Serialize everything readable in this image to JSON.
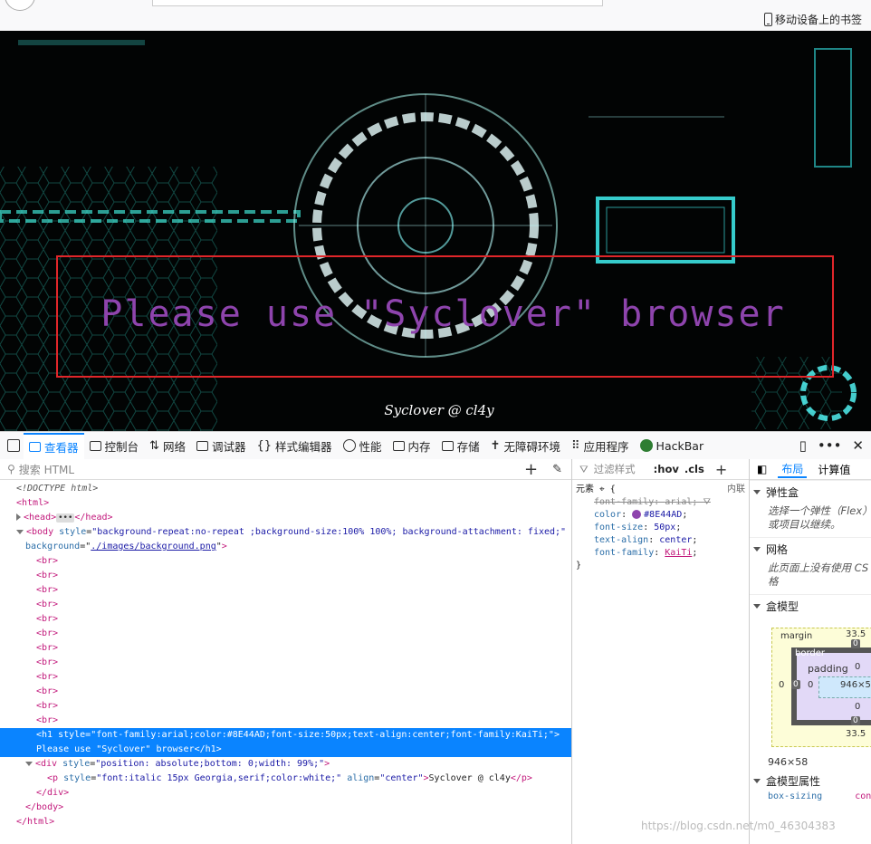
{
  "browser": {
    "bookmark_label": "移动设备上的书签"
  },
  "page": {
    "heading": "Please use \"Syclover\" browser",
    "footer": "Syclover @ cl4y",
    "heading_color": "#8E44AD",
    "highlight_color": "#e0262a"
  },
  "devtools": {
    "tabs": [
      {
        "label": "查看器",
        "icon": "inspector-icon"
      },
      {
        "label": "控制台",
        "icon": "console-icon"
      },
      {
        "label": "网络",
        "icon": "network-icon"
      },
      {
        "label": "调试器",
        "icon": "debugger-icon"
      },
      {
        "label": "样式编辑器",
        "icon": "style-editor-icon"
      },
      {
        "label": "性能",
        "icon": "performance-icon"
      },
      {
        "label": "内存",
        "icon": "memory-icon"
      },
      {
        "label": "存储",
        "icon": "storage-icon"
      },
      {
        "label": "无障碍环境",
        "icon": "accessibility-icon"
      },
      {
        "label": "应用程序",
        "icon": "application-icon"
      },
      {
        "label": "HackBar",
        "icon": "hackbar-icon"
      }
    ],
    "search_placeholder": "搜索 HTML",
    "filter_placeholder": "过滤样式",
    "hov": ":hov",
    "cls": ".cls",
    "rule_selector": "元素",
    "rule_source": "内联",
    "rules": {
      "decl1_prop": "font-family",
      "decl1_val": "arial",
      "decl2_prop": "color",
      "decl2_val": "#8E44AD",
      "decl3_prop": "font-size",
      "decl3_val": "50px",
      "decl4_prop": "text-align",
      "decl4_val": "center",
      "decl5_prop": "font-family",
      "decl5_val": "KaiTi"
    },
    "html": {
      "doctype": "<!DOCTYPE html>",
      "html_open": "<html>",
      "head_open": "<head>",
      "head_close": "</head>",
      "body_open": "<body",
      "body_style_attr": "style",
      "body_style_val": "\"background-repeat:no-repeat ;background-size:100% 100%; background-attachment: fixed;\"",
      "body_bg_attr": "background",
      "body_bg_val": "./images/background.png",
      "br": "<br>",
      "h1_line": "<h1 style=\"font-family:arial;color:#8E44AD;font-size:50px;text-align:center;font-family:KaiTi;\">",
      "h1_text": "Please use \"Syclover\" browser</h1>",
      "div_open": "<div",
      "div_style_attr": "style",
      "div_style_val": "\"position: absolute;bottom: 0;width: 99%;\"",
      "p_open": "<p",
      "p_style_attr": "style",
      "p_style_val": "\"font:italic 15px Georgia,serif;color:white;\"",
      "p_align_attr": "align",
      "p_align_val": "\"center\"",
      "p_text": "Syclover @ cl4y",
      "p_close": "</p>",
      "div_close": "</div>",
      "body_close": "</body>",
      "html_close": "</html>"
    },
    "right_tabs": {
      "layout": "布局",
      "computed": "计算值"
    },
    "flex_title": "弹性盒",
    "flex_body_1": "选择一个弹性（Flex）",
    "flex_body_2": "或项目以继续。",
    "grid_title": "网格",
    "grid_body_1": "此页面上没有使用 CS",
    "grid_body_2": "格",
    "boxmodel_title": "盒模型",
    "boxmodel": {
      "margin_label": "margin",
      "border_label": "border",
      "padding_label": "padding",
      "margin_top": "33.5",
      "margin_bottom": "33.5",
      "margin_left": "0",
      "border_top": "0",
      "border_bottom": "0",
      "border_left": "0",
      "padding_top": "0",
      "padding_bottom": "0",
      "padding_left": "0",
      "content_size": "946×58"
    },
    "element_size": "946×58",
    "boxmodel_props_title": "盒模型属性",
    "box_sizing_prop": "box-sizing",
    "box_sizing_val": "con"
  },
  "watermark": "https://blog.csdn.net/m0_46304383"
}
